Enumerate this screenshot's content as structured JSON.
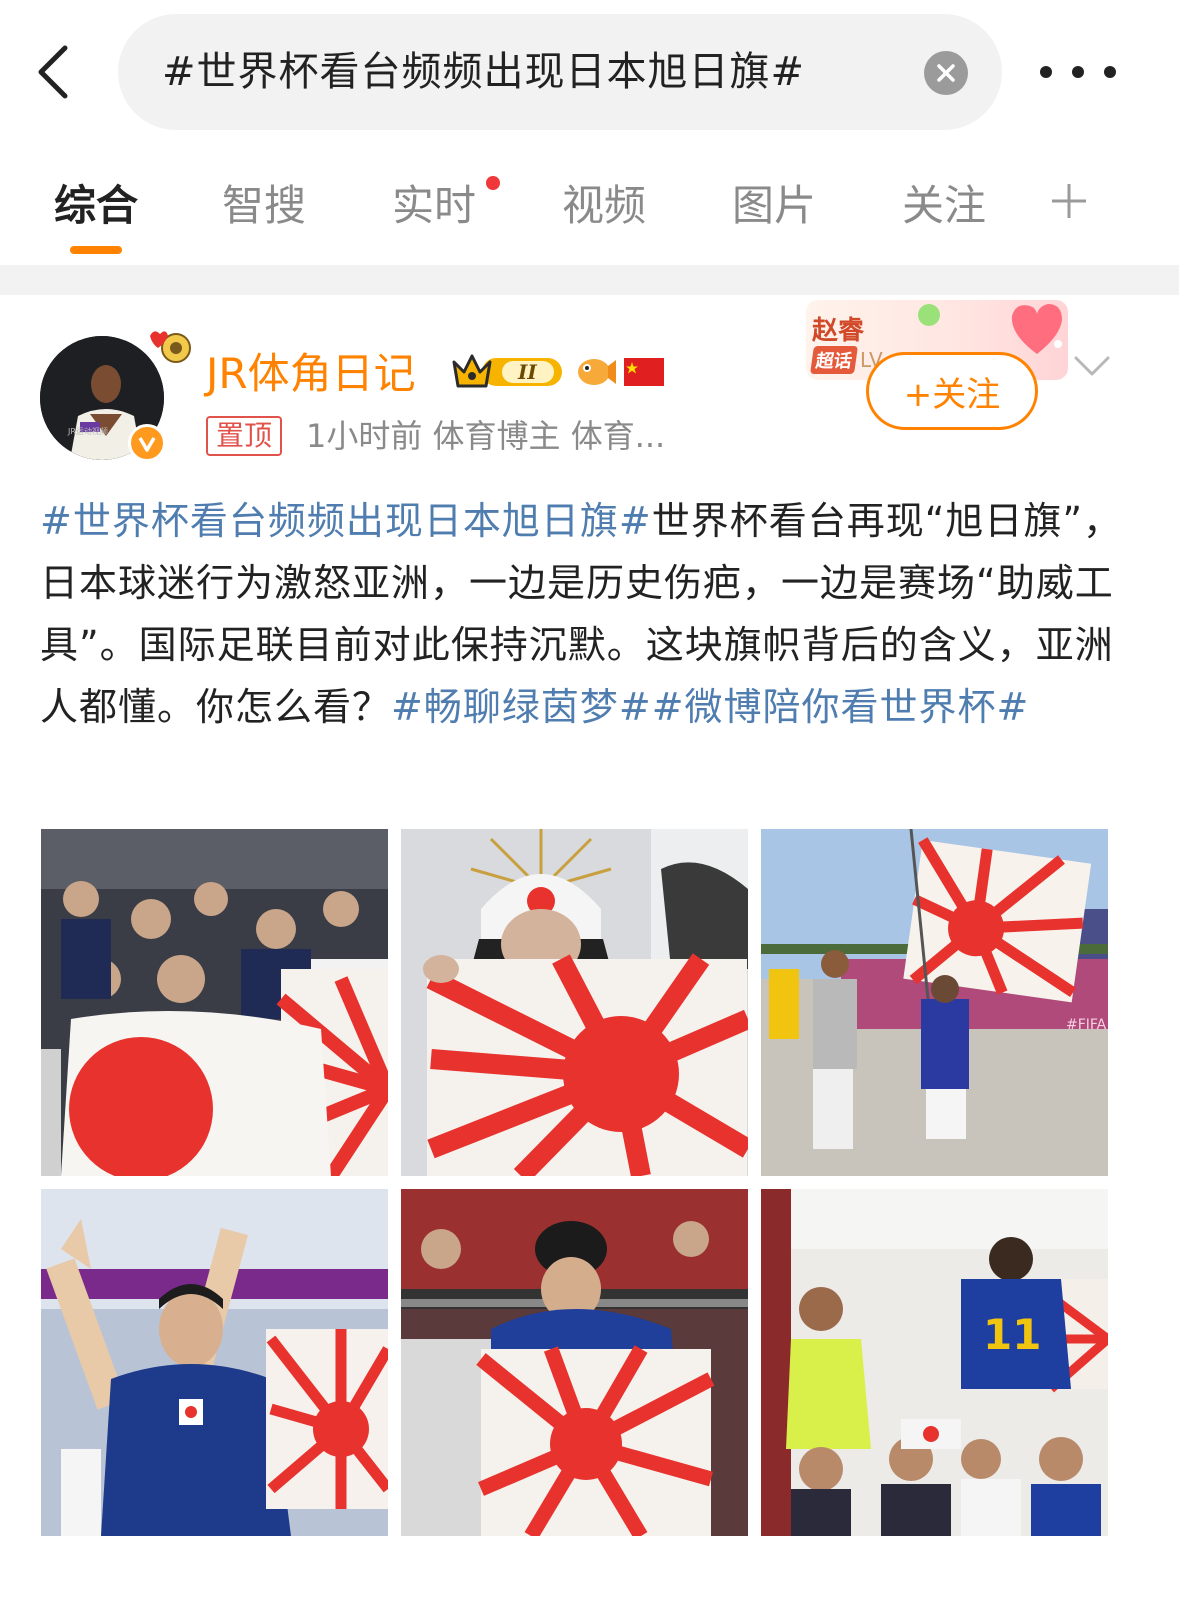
{
  "search": {
    "query": "#世界杯看台频频出现日本旭日旗#"
  },
  "tabs": [
    {
      "label": "综合",
      "active": true
    },
    {
      "label": "智搜"
    },
    {
      "label": "实时",
      "has_dot": true
    },
    {
      "label": "视频"
    },
    {
      "label": "图片"
    },
    {
      "label": "关注"
    }
  ],
  "post": {
    "author": "JR体角日记",
    "avatar_watermark": "JR运动视频",
    "vip_level": "II",
    "pinned_label": "置顶",
    "meta": "1小时前  体育博主 体育...",
    "superchat": {
      "name": "赵睿",
      "tag": "超话",
      "suffix": "LV"
    },
    "follow_label": "+关注",
    "text": {
      "hashtag1": "#世界杯看台频频出现日本旭日旗#",
      "body": "世界杯看台再现“旭日旗”，日本球迷行为激怒亚洲，一边是历史伤疤，一边是赛场“助威工具”。国际足联目前对此保持沉默。这块旗帜背后的含义，亚洲人都懂。你怎么看？",
      "hashtag2": "#畅聊绿茵梦#",
      "hashtag3": "#微博陪你看世界杯#"
    },
    "photos": [
      {
        "name": "photo-1",
        "jersey_text": ""
      },
      {
        "name": "photo-2",
        "jersey_text": ""
      },
      {
        "name": "photo-3",
        "jersey_text": "#FIFA"
      },
      {
        "name": "photo-4",
        "jersey_text": ""
      },
      {
        "name": "photo-5",
        "jersey_text": ""
      },
      {
        "name": "photo-6",
        "jersey_text": "11"
      }
    ]
  },
  "colors": {
    "accent": "#ff8200",
    "hashtag": "#507daf",
    "muted": "#8a8a8a",
    "flag_red": "#e8322e"
  }
}
